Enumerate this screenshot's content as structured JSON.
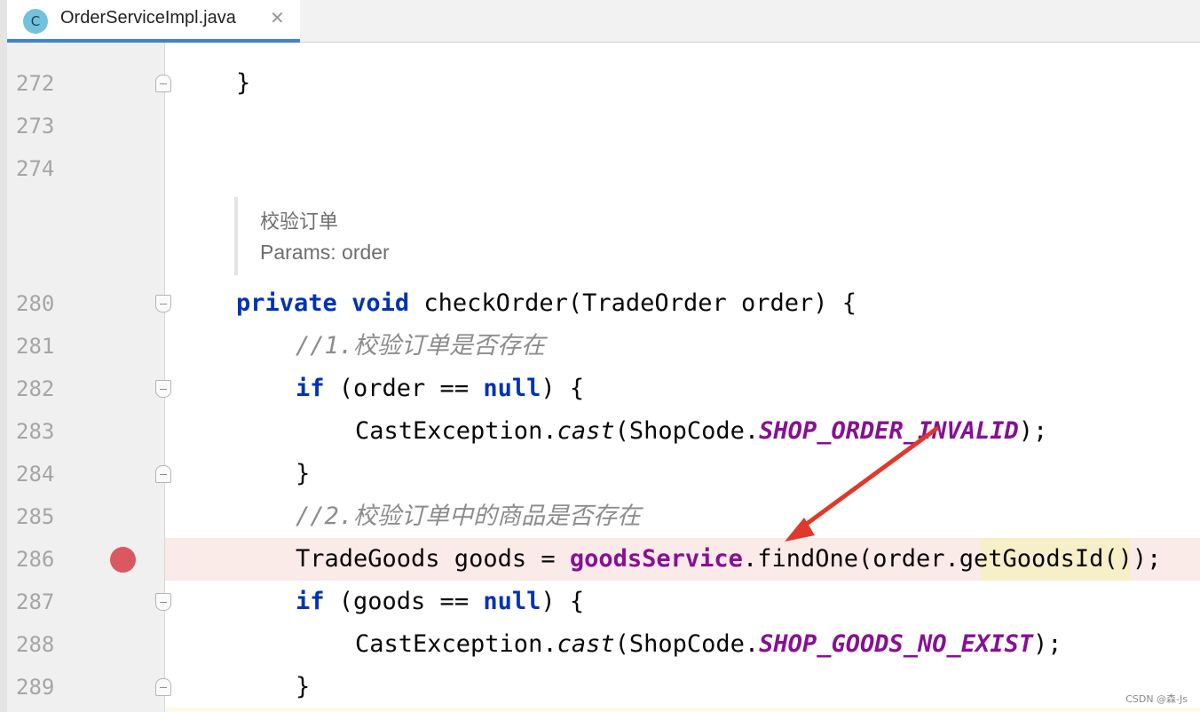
{
  "tab": {
    "icon_letter": "C",
    "title": "OrderServiceImpl.java",
    "close_glyph": "✕"
  },
  "gutter": {
    "lines": [
      "272",
      "273",
      "274",
      "280",
      "281",
      "282",
      "283",
      "284",
      "285",
      "286",
      "287",
      "288",
      "289"
    ],
    "breakpoint_line": "286"
  },
  "doc": {
    "title": "校验订单",
    "params": "Params: order"
  },
  "code": {
    "l272": {
      "brace": "}"
    },
    "l280": {
      "kw1": "private",
      "kw2": "void",
      "rest": " checkOrder(TradeOrder order) {"
    },
    "l281": {
      "comment": "//1.校验订单是否存在"
    },
    "l282": {
      "kw": "if",
      "mid": " (order == ",
      "null": "null",
      "end": ") {"
    },
    "l283": {
      "cls": "CastException.",
      "method": "cast",
      "mid": "(ShopCode.",
      "const": "SHOP_ORDER_INVALID",
      "end": ");"
    },
    "l284": {
      "brace": "}"
    },
    "l285": {
      "comment": "//2.校验订单中的商品是否存在"
    },
    "l286": {
      "start": "TradeGoods goods = ",
      "field": "goodsService",
      "mid": ".findOne(order.",
      "getter": "getGoodsId",
      "end": "());"
    },
    "l287": {
      "kw": "if",
      "mid": " (goods == ",
      "null": "null",
      "end": ") {"
    },
    "l288": {
      "cls": "CastException.",
      "method": "cast",
      "mid": "(ShopCode.",
      "const": "SHOP_GOODS_NO_EXIST",
      "end": ");"
    },
    "l289": {
      "brace": "}"
    }
  },
  "annotation": {
    "arrow_color": "#e0392b"
  },
  "watermark": "CSDN @森-Js"
}
